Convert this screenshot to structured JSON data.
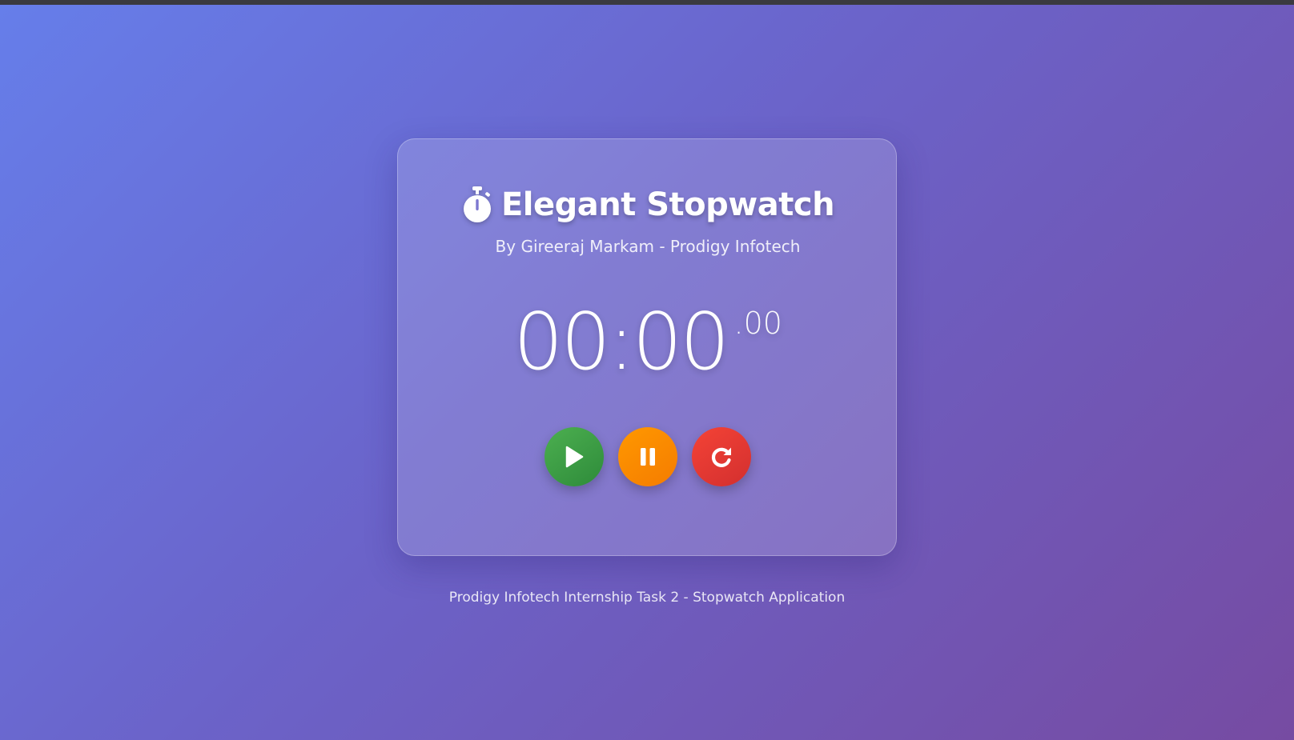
{
  "app": {
    "title": "Elegant Stopwatch",
    "subtitle": "By Gireeraj Markam - Prodigy Infotech",
    "title_icon": "stopwatch-icon"
  },
  "display": {
    "time": "00:00",
    "milliseconds": ".00"
  },
  "controls": [
    {
      "name": "start-button",
      "icon": "play-icon",
      "color": "#43a047"
    },
    {
      "name": "pause-button",
      "icon": "pause-icon",
      "color": "#fb8c00"
    },
    {
      "name": "reset-button",
      "icon": "refresh-icon",
      "color": "#e53935"
    }
  ],
  "footer": {
    "text": "Prodigy Infotech Internship Task 2 - Stopwatch Application"
  },
  "colors": {
    "background_start": "#667eea",
    "background_end": "#764ba2",
    "start": "#43a047",
    "pause": "#fb8c00",
    "reset": "#e53935"
  }
}
